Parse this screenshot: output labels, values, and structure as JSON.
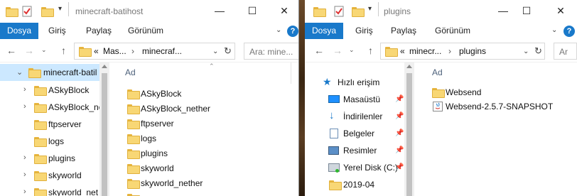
{
  "window1": {
    "title": "minecraft-batihost",
    "ribbon_tabs": [
      "Dosya",
      "Giriş",
      "Paylaş",
      "Görünüm"
    ],
    "address_parts": [
      "«",
      "Mas...",
      "minecraf..."
    ],
    "search_placeholder": "Ara: mine...",
    "column_header": "Ad",
    "tree_items": [
      {
        "label": "minecraft-batil",
        "expanded": true,
        "selected": true
      },
      {
        "label": "ASkyBlock",
        "expanded": false
      },
      {
        "label": "ASkyBlock_ne",
        "expanded": false
      },
      {
        "label": "ftpserver",
        "expanded": false
      },
      {
        "label": "logs",
        "expanded": false
      },
      {
        "label": "plugins",
        "expanded": false
      },
      {
        "label": "skyworld",
        "expanded": false
      },
      {
        "label": "skyworld_net",
        "expanded": false
      }
    ],
    "files": [
      "ASkyBlock",
      "ASkyBlock_nether",
      "ftpserver",
      "logs",
      "plugins",
      "skyworld",
      "skyworld_nether"
    ]
  },
  "window2": {
    "title": "plugins",
    "ribbon_tabs": [
      "Dosya",
      "Giriş",
      "Paylaş",
      "Görünüm"
    ],
    "address_parts": [
      "«",
      "minecr...",
      "plugins"
    ],
    "search_placeholder": "Ar",
    "column_header": "Ad",
    "quick_access": "Hızlı erişim",
    "nav_items": [
      "Masaüstü",
      "İndirilenler",
      "Belgeler",
      "Resimler",
      "Yerel Disk (C:)",
      "2019-04"
    ],
    "files": [
      "Websend",
      "Websend-2.5.7-SNAPSHOT"
    ]
  },
  "colors": {
    "accent": "#1979ca",
    "selection": "#cce8ff",
    "folder": "#f8d775"
  }
}
